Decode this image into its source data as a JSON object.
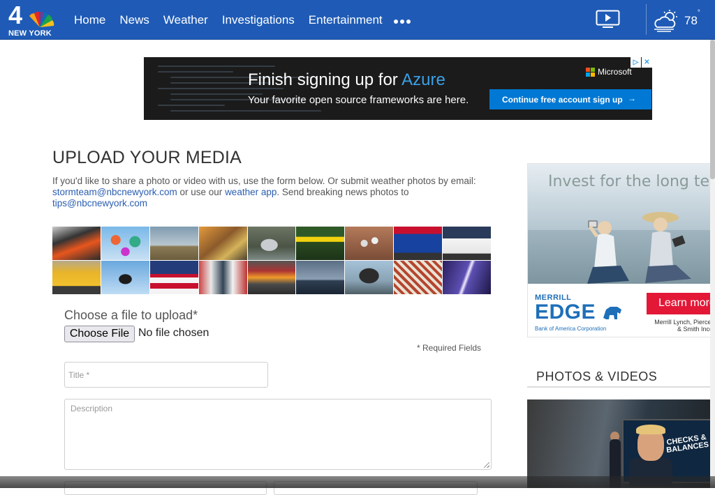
{
  "header": {
    "logo_number": "4",
    "logo_city": "NEW YORK",
    "nav": [
      "Home",
      "News",
      "Weather",
      "Investigations",
      "Entertainment"
    ],
    "temperature": "78",
    "temperature_unit": "°"
  },
  "top_ad": {
    "headline_prefix": "Finish signing up for ",
    "headline_accent": "Azure",
    "subline": "Your favorite open source frameworks are here.",
    "brand": "Microsoft",
    "cta": "Continue free account sign up",
    "cta_arrow": "→",
    "adchoice_icon": "▷",
    "close_icon": "✕",
    "colors": {
      "accent": "#3aa0e6",
      "cta_bg": "#0078d4"
    }
  },
  "main": {
    "title": "UPLOAD YOUR MEDIA",
    "intro_1": "If you'd like to share a photo or video with us, use the form below. Or submit weather photos by email: ",
    "email": "stormteam@nbcnewyork.com",
    "intro_2": " or use our ",
    "app_link": "weather app",
    "intro_3": ". Send breaking news photos to ",
    "tips_email": "tips@nbcnewyork.com",
    "mosaic_tiles": [
      "fire",
      "hot-air-balloons",
      "tornado",
      "firefighters",
      "flooded-car",
      "police-tape",
      "hail",
      "gas-prices",
      "police-car",
      "school-bus",
      "helicopter",
      "american-flag",
      "baseball-fans",
      "truck-fire",
      "bridge",
      "volcano-smoke",
      "cyclone-rollercoaster",
      "lightning"
    ]
  },
  "form": {
    "choose_label": "Choose a file to upload*",
    "choose_button": "Choose File",
    "file_status": "No file chosen",
    "required_note": "*  Required Fields",
    "title_placeholder": "Title *",
    "description_placeholder": "Description"
  },
  "side_ad": {
    "tagline": "Invest for the long term",
    "brand_top": "MERRILL",
    "brand_main": "EDGE",
    "brand_sub": "Bank of America Corporation",
    "cta": "Learn more",
    "fine_print_1": "Merrill Lynch, Pierce, Fe",
    "fine_print_2": "& Smith Incorpo",
    "colors": {
      "brand": "#1e6fb8",
      "cta": "#e31837"
    }
  },
  "photos_videos": {
    "title": "PHOTOS & VIDEOS",
    "video_overlay": "CHECKS & BALANCES"
  },
  "colors": {
    "nav_bg": "#1f5bb6",
    "link": "#2a5db0"
  }
}
